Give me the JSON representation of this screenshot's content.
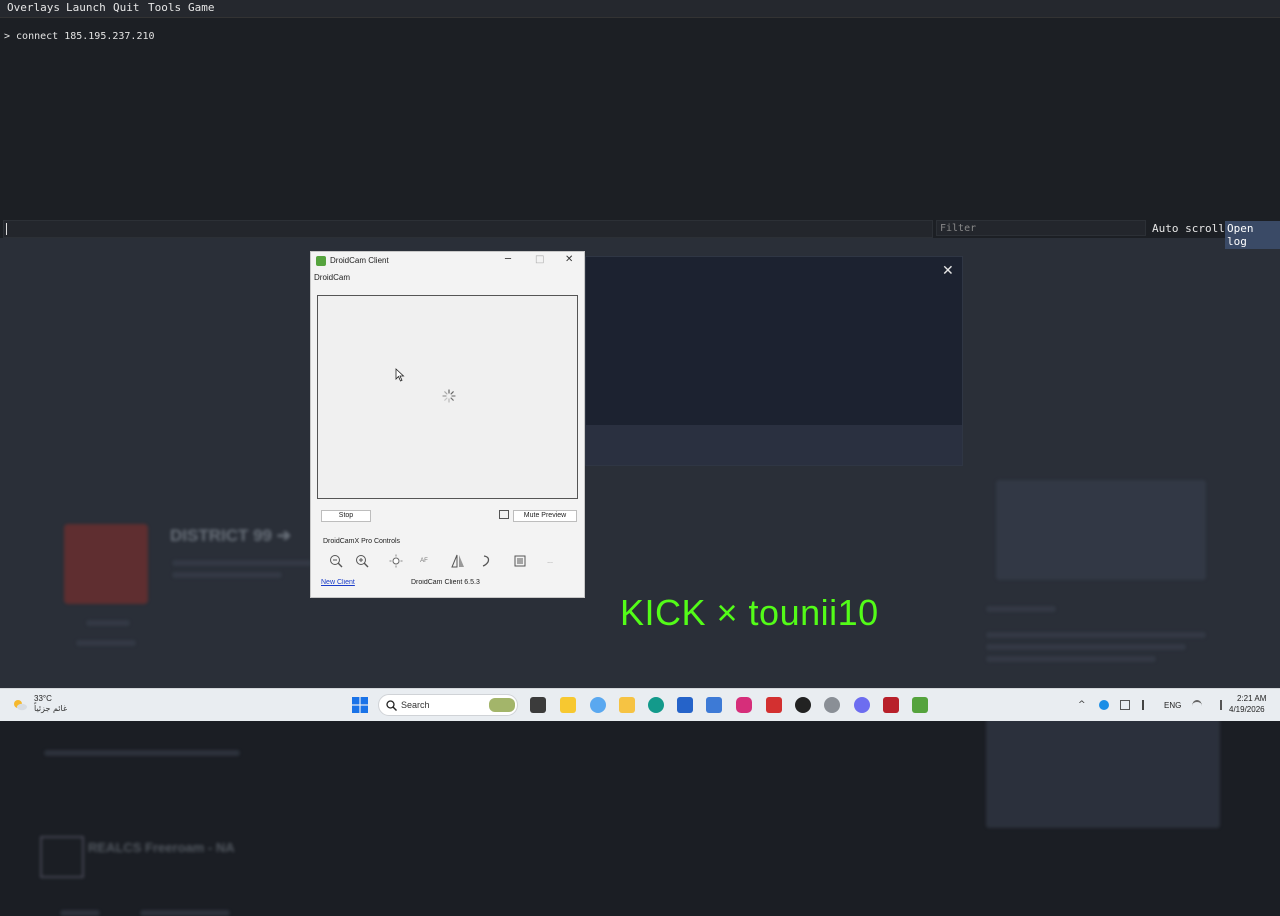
{
  "console": {
    "menu": [
      "Overlays",
      "Launch",
      "Quit",
      "Tools",
      "Game"
    ],
    "output_line": "> connect 185.195.237.210",
    "filter_placeholder": "Filter",
    "auto_scroll_label": "Auto scroll",
    "open_log_label": "Open log"
  },
  "background": {
    "server_title": "DISTRICT 99 ➔",
    "server2_title": "REALCS Freeroam - NA"
  },
  "modal": {
    "close_glyph": "✕"
  },
  "droidcam": {
    "window_title": "DroidCam Client",
    "menu_label": "DroidCam",
    "stop_label": "Stop",
    "mute_preview_label": "Mute Preview",
    "pro_controls_label": "DroidCamX Pro Controls",
    "tools": [
      "zoom-out-icon",
      "zoom-in-icon",
      "light-icon",
      "autofocus-icon",
      "mirror-icon",
      "rotate-icon",
      "settings-icon",
      "more-icon"
    ],
    "autofocus_text": "AF",
    "more_text": "...",
    "new_client_label": "New Client",
    "version": "DroidCam Client 6.5.3",
    "minimize_glyph": "─",
    "maximize_glyph": "□",
    "close_glyph": "✕"
  },
  "overlay": {
    "stream_text": "KICK × tounii10",
    "color": "#53fc18"
  },
  "taskbar": {
    "weather_temp": "33°C",
    "weather_desc": "غائم جزئياً",
    "search_label": "Search",
    "language": "ENG",
    "time": "2:21 AM",
    "date": "4/19/2026"
  }
}
